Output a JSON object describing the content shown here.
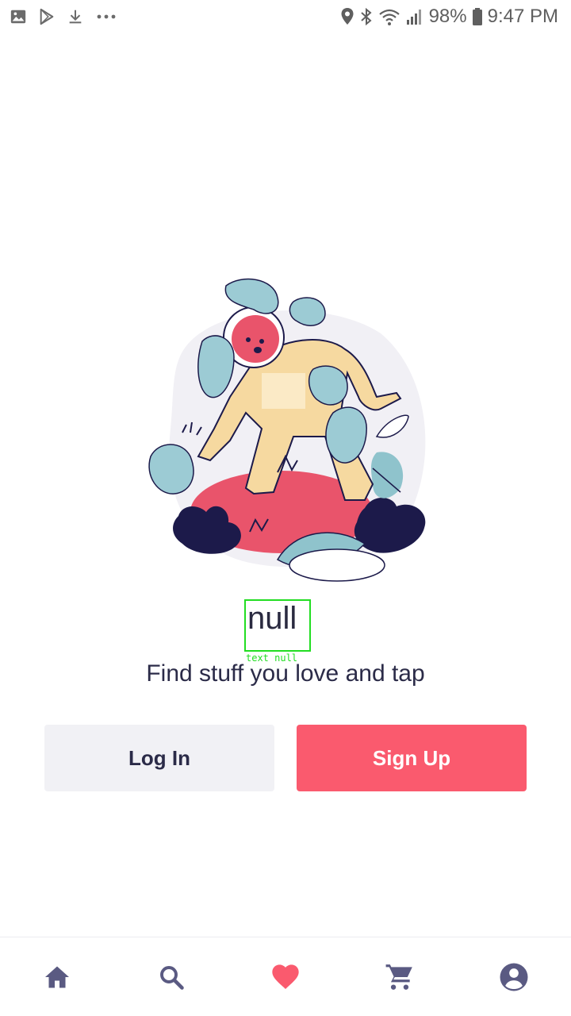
{
  "status_bar": {
    "battery": "98%",
    "time": "9:47 PM",
    "left_icons": [
      "image-icon",
      "play-store-icon",
      "download-icon",
      "more-dots-icon"
    ],
    "right_icons": [
      "location-icon",
      "bluetooth-icon",
      "wifi-icon",
      "signal-icon",
      "battery-icon"
    ]
  },
  "main": {
    "title": "null",
    "debug_label": "text null",
    "subtitle": "Find stuff you love and tap",
    "login_label": "Log In",
    "signup_label": "Sign Up"
  },
  "bottom_nav": {
    "items": [
      "home-icon",
      "search-icon",
      "heart-icon",
      "cart-icon",
      "profile-icon"
    ],
    "active": "heart-icon"
  },
  "colors": {
    "accent": "#fa5a6e",
    "dark_text": "#2b2b48",
    "nav_icon": "#5a5a82",
    "login_bg": "#f1f1f5"
  }
}
